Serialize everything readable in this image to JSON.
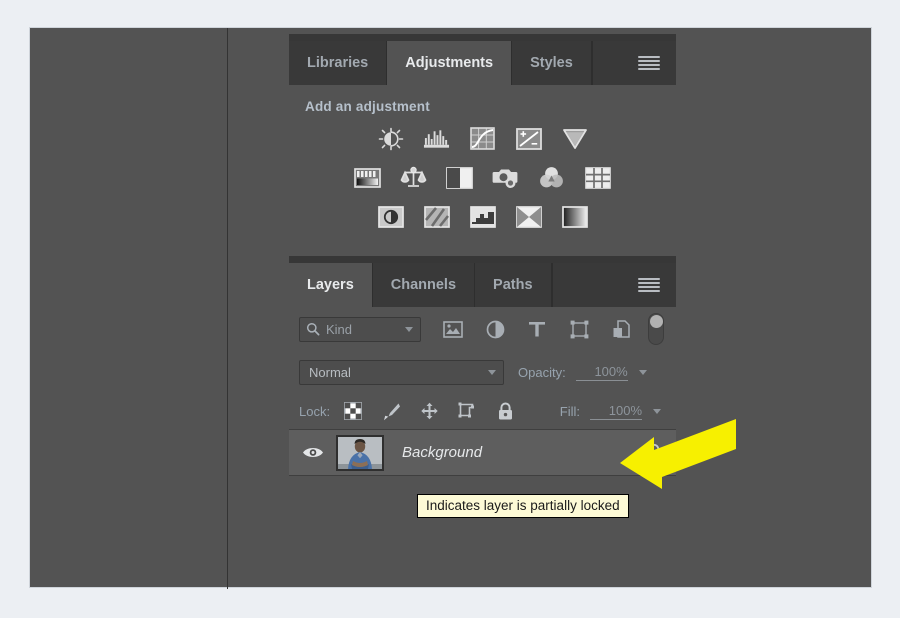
{
  "window": {
    "background_color": "#535353",
    "page_background": "#eceff3"
  },
  "adjustments_panel": {
    "tabs": [
      {
        "label": "Libraries",
        "active": false
      },
      {
        "label": "Adjustments",
        "active": true
      },
      {
        "label": "Styles",
        "active": false
      }
    ],
    "menu_icon": "hamburger-menu-icon",
    "title": "Add an adjustment",
    "rows": [
      {
        "icons": [
          {
            "name": "brightness-contrast-icon",
            "label": "Brightness/Contrast"
          },
          {
            "name": "levels-icon",
            "label": "Levels"
          },
          {
            "name": "curves-icon",
            "label": "Curves"
          },
          {
            "name": "exposure-icon",
            "label": "Exposure"
          },
          {
            "name": "vibrance-icon",
            "label": "Vibrance"
          }
        ]
      },
      {
        "icons": [
          {
            "name": "hue-saturation-icon",
            "label": "Hue/Saturation"
          },
          {
            "name": "color-balance-icon",
            "label": "Color Balance"
          },
          {
            "name": "black-and-white-icon",
            "label": "Black & White"
          },
          {
            "name": "photo-filter-icon",
            "label": "Photo Filter"
          },
          {
            "name": "channel-mixer-icon",
            "label": "Channel Mixer"
          },
          {
            "name": "color-lookup-icon",
            "label": "Color Lookup"
          }
        ]
      },
      {
        "icons": [
          {
            "name": "invert-icon",
            "label": "Invert"
          },
          {
            "name": "posterize-icon",
            "label": "Posterize"
          },
          {
            "name": "threshold-icon",
            "label": "Threshold"
          },
          {
            "name": "gradient-map-icon",
            "label": "Gradient Map"
          },
          {
            "name": "selective-color-icon",
            "label": "Selective Color"
          }
        ]
      }
    ]
  },
  "layers_panel": {
    "tabs": [
      {
        "label": "Layers",
        "active": true
      },
      {
        "label": "Channels",
        "active": false
      },
      {
        "label": "Paths",
        "active": false
      }
    ],
    "menu_icon": "hamburger-menu-icon",
    "filter": {
      "search_icon": "search-icon",
      "kind_label": "Kind",
      "type_filters": [
        {
          "name": "filter-pixel-layers-icon"
        },
        {
          "name": "filter-adjustment-layers-icon"
        },
        {
          "name": "filter-type-layers-icon"
        },
        {
          "name": "filter-shape-layers-icon"
        },
        {
          "name": "filter-smart-object-layers-icon"
        }
      ],
      "toggle_name": "filter-enable-toggle"
    },
    "blend": {
      "mode": "Normal",
      "opacity_label": "Opacity:",
      "opacity_value": "100%"
    },
    "lock": {
      "label": "Lock:",
      "buttons": [
        {
          "name": "lock-transparent-pixels-icon"
        },
        {
          "name": "lock-image-pixels-icon"
        },
        {
          "name": "lock-position-icon"
        },
        {
          "name": "lock-artboard-nesting-icon"
        },
        {
          "name": "lock-all-icon"
        }
      ],
      "fill_label": "Fill:",
      "fill_value": "100%"
    },
    "layers": [
      {
        "visible": true,
        "name": "Background",
        "locked": true,
        "thumbnail": "portrait-thumbnail"
      }
    ]
  },
  "tooltip": {
    "text": "Indicates layer is partially locked",
    "background_color": "#fdfad6",
    "border_color": "#000000"
  },
  "annotation": {
    "arrow_color": "#f7f000",
    "name": "yellow-pointer-arrow"
  }
}
